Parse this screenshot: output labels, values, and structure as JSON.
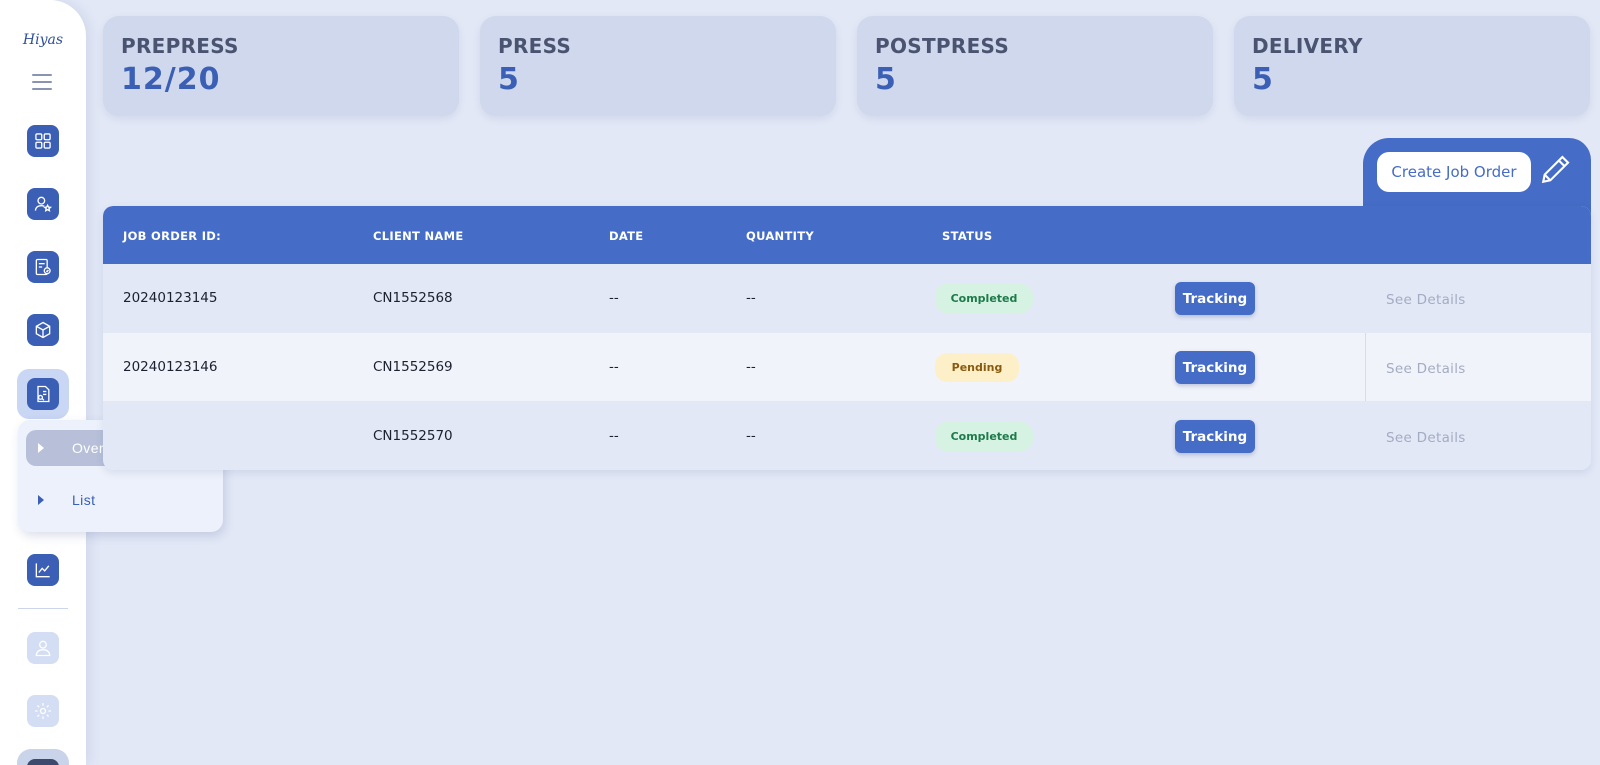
{
  "brand": {
    "logo_text": "Hiyas"
  },
  "stats": [
    {
      "title": "PREPRESS",
      "value": "12/20"
    },
    {
      "title": "PRESS",
      "value": "5"
    },
    {
      "title": "POSTPRESS",
      "value": "5"
    },
    {
      "title": "DELIVERY",
      "value": "5"
    }
  ],
  "actions": {
    "create_job_order": "Create Job Order"
  },
  "flyout": {
    "items": [
      "Overview",
      "List"
    ],
    "active": "Overview"
  },
  "table": {
    "headers": [
      "JOB ORDER ID:",
      "CLIENT NAME",
      "DATE",
      "QUANTITY",
      "STATUS"
    ],
    "rows": [
      {
        "job_order_id": "20240123145",
        "client_name": "CN1552568",
        "date": "--",
        "quantity": "--",
        "status": "Completed",
        "tracking": "Tracking",
        "details": "See Details"
      },
      {
        "job_order_id": "20240123146",
        "client_name": "CN1552569",
        "date": "--",
        "quantity": "--",
        "status": "Pending",
        "tracking": "Tracking",
        "details": "See Details"
      },
      {
        "job_order_id": "",
        "client_name": "CN1552570",
        "date": "--",
        "quantity": "--",
        "status": "Completed",
        "tracking": "Tracking",
        "details": "See Details"
      }
    ]
  },
  "colors": {
    "accent": "#456cc6",
    "page_background": "#e2e8f6",
    "card_background": "#cfd8ec",
    "status_completed_bg": "#d6f2e2",
    "status_pending_bg": "#fdf0c8"
  }
}
